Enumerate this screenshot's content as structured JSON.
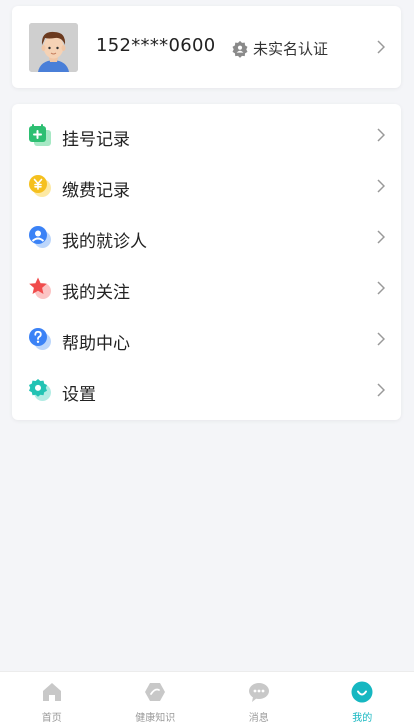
{
  "profile": {
    "phone": "152****0600",
    "verify_status": "未实名认证"
  },
  "menu": {
    "items": [
      {
        "label": "挂号记录",
        "icon": "register-record-icon",
        "color": "#2dbf72"
      },
      {
        "label": "缴费记录",
        "icon": "payment-record-icon",
        "color": "#f5c01e"
      },
      {
        "label": "我的就诊人",
        "icon": "patient-icon",
        "color": "#3b82f6"
      },
      {
        "label": "我的关注",
        "icon": "star-icon",
        "color": "#f04c4c"
      },
      {
        "label": "帮助中心",
        "icon": "help-icon",
        "color": "#3b82f6"
      },
      {
        "label": "设置",
        "icon": "settings-icon",
        "color": "#22c3b4"
      }
    ]
  },
  "tabbar": {
    "tabs": [
      {
        "label": "首页",
        "icon": "home-icon",
        "active": false
      },
      {
        "label": "健康知识",
        "icon": "health-knowledge-icon",
        "active": false
      },
      {
        "label": "消息",
        "icon": "message-icon",
        "active": false
      },
      {
        "label": "我的",
        "icon": "profile-tab-icon",
        "active": true
      }
    ],
    "active_color": "#16b7c1",
    "inactive_color": "#c8c8c8"
  }
}
